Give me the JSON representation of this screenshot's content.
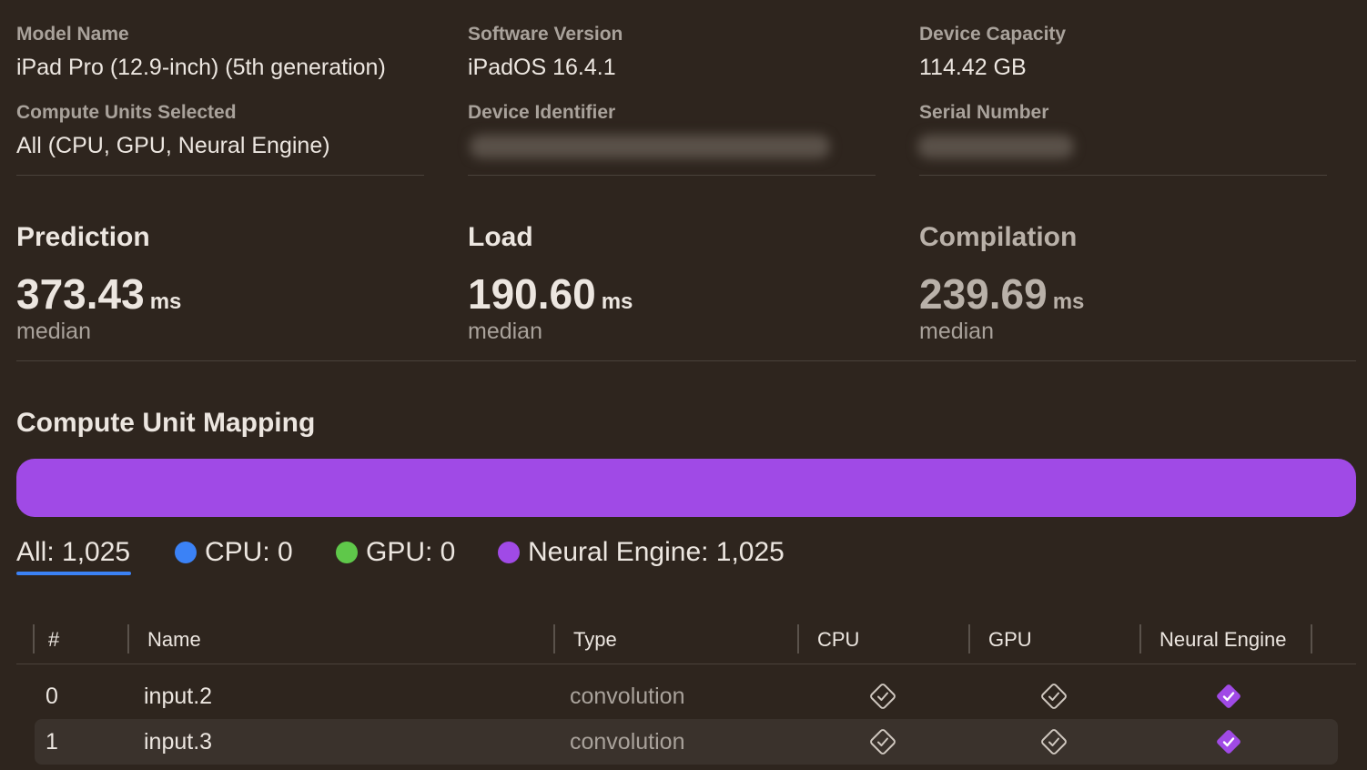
{
  "device": {
    "model_name_label": "Model Name",
    "model_name": "iPad Pro (12.9-inch) (5th generation)",
    "software_version_label": "Software Version",
    "software_version": "iPadOS 16.4.1",
    "device_capacity_label": "Device Capacity",
    "device_capacity": "114.42 GB",
    "compute_units_label": "Compute Units Selected",
    "compute_units": "All (CPU, GPU, Neural Engine)",
    "device_identifier_label": "Device Identifier",
    "serial_number_label": "Serial Number"
  },
  "metrics": {
    "prediction": {
      "title": "Prediction",
      "value": "373.43",
      "unit": "ms",
      "sub": "median"
    },
    "load": {
      "title": "Load",
      "value": "190.60",
      "unit": "ms",
      "sub": "median"
    },
    "compilation": {
      "title": "Compilation",
      "value": "239.69",
      "unit": "ms",
      "sub": "median"
    }
  },
  "mapping": {
    "title": "Compute Unit Mapping",
    "neural_engine_fraction": 1.0,
    "tabs": {
      "all": "All: 1,025",
      "cpu": "CPU: 0",
      "gpu": "GPU: 0",
      "neural_engine": "Neural Engine: 1,025"
    },
    "colors": {
      "cpu": "#3b82f6",
      "gpu": "#5fc84a",
      "neural_engine": "#a04ae6",
      "selected_underline": "#3b82f6"
    }
  },
  "table": {
    "headers": {
      "index": "#",
      "name": "Name",
      "type": "Type",
      "cpu": "CPU",
      "gpu": "GPU",
      "neural_engine": "Neural Engine"
    },
    "rows": [
      {
        "index": "0",
        "name": "input.2",
        "type": "convolution",
        "cpu": false,
        "gpu": false,
        "neural_engine": true
      },
      {
        "index": "1",
        "name": "input.3",
        "type": "convolution",
        "cpu": false,
        "gpu": false,
        "neural_engine": true
      }
    ]
  }
}
